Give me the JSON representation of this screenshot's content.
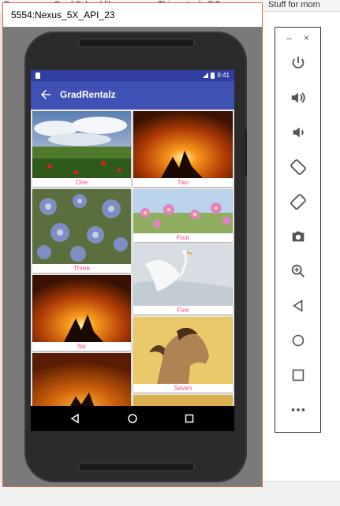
{
  "desktop": {
    "tab_fragments": [
      "G",
      "Grad School lik",
      "Things to do DC",
      "Stuff for mom"
    ]
  },
  "emulator": {
    "title": "5554:Nexus_5X_API_23",
    "status_time": "9:41",
    "app_title": "GradRentalz",
    "items": [
      {
        "label": "One"
      },
      {
        "label": "Two"
      },
      {
        "label": "Three"
      },
      {
        "label": "Four"
      },
      {
        "label": "Five"
      },
      {
        "label": "Six"
      },
      {
        "label": "Seven"
      },
      {
        "label": ""
      },
      {
        "label": ""
      }
    ]
  },
  "controls": {
    "minimize": "–",
    "close": "×",
    "buttons": [
      "power-icon",
      "volume-up-icon",
      "volume-down-icon",
      "rotate-left-icon",
      "rotate-right-icon",
      "camera-icon",
      "zoom-icon",
      "back-icon",
      "home-icon",
      "overview-icon",
      "more-icon"
    ]
  },
  "colors": {
    "primary": "#3f51b5",
    "primary_dark": "#303f9f",
    "accent": "#ff4081"
  }
}
